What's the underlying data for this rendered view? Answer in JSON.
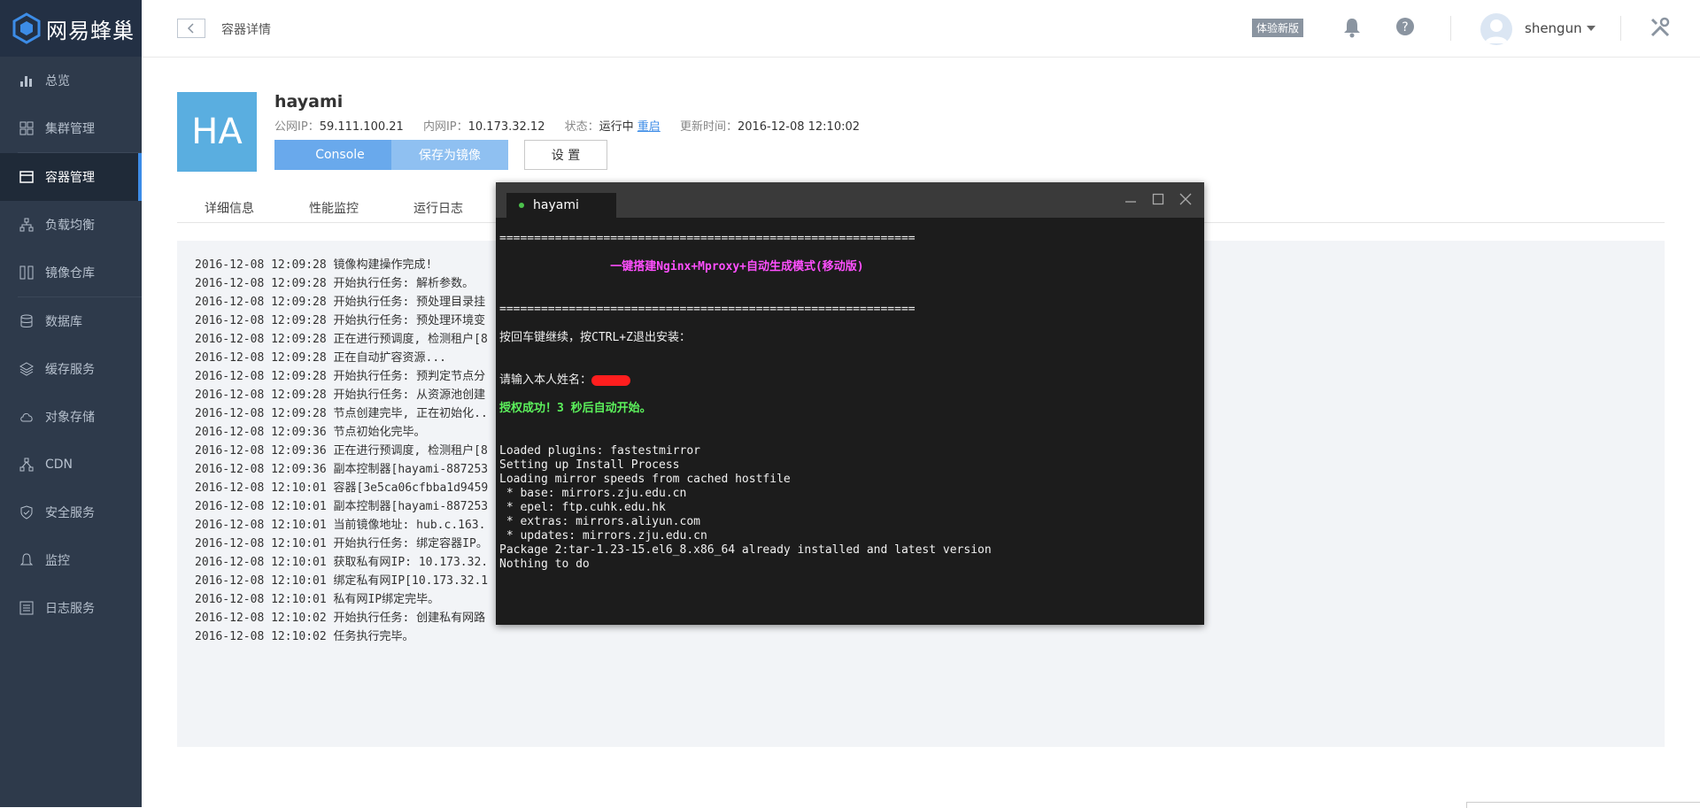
{
  "brand": {
    "name": "网易蜂巢"
  },
  "sidebar": {
    "items": [
      {
        "label": "总览",
        "icon": "bar-chart-icon"
      },
      {
        "label": "集群管理",
        "icon": "grid-icon"
      },
      {
        "label": "容器管理",
        "icon": "window-icon",
        "active": true
      },
      {
        "label": "负载均衡",
        "icon": "nodes-icon"
      },
      {
        "label": "镜像仓库",
        "icon": "columns-icon"
      },
      {
        "label": "数据库",
        "icon": "database-icon"
      },
      {
        "label": "缓存服务",
        "icon": "layers-icon"
      },
      {
        "label": "对象存储",
        "icon": "cloud-icon"
      },
      {
        "label": "CDN",
        "icon": "network-icon"
      },
      {
        "label": "安全服务",
        "icon": "shield-icon"
      },
      {
        "label": "监控",
        "icon": "bell-icon"
      },
      {
        "label": "日志服务",
        "icon": "list-icon"
      }
    ]
  },
  "header": {
    "breadcrumb": "容器详情",
    "trial_badge": "体验新版",
    "username": "shengun"
  },
  "container": {
    "avatar_text": "HA",
    "name": "hayami",
    "public_ip_label": "公网IP：",
    "public_ip": "59.111.100.21",
    "private_ip_label": "内网IP：",
    "private_ip": "10.173.32.12",
    "status_label": "状态：",
    "status": "运行中",
    "restart_link": "重启",
    "updated_label": "更新时间：",
    "updated": "2016-12-08 12:10:02"
  },
  "actions": {
    "console": "Console",
    "save_image": "保存为镜像",
    "settings": "设 置"
  },
  "tabs": [
    "详细信息",
    "性能监控",
    "运行日志"
  ],
  "logs": [
    "2016-12-08 12:09:28 镜像构建操作完成!",
    "2016-12-08 12:09:28 开始执行任务: 解析参数。",
    "2016-12-08 12:09:28 开始执行任务: 预处理目录挂",
    "2016-12-08 12:09:28 开始执行任务: 预处理环境变",
    "2016-12-08 12:09:28 正在进行预调度, 检测租户[8",
    "2016-12-08 12:09:28 正在自动扩容资源...",
    "2016-12-08 12:09:28 开始执行任务: 预判定节点分",
    "2016-12-08 12:09:28 开始执行任务: 从资源池创建",
    "2016-12-08 12:09:28 节点创建完毕, 正在初始化..",
    "2016-12-08 12:09:36 节点初始化完毕。",
    "2016-12-08 12:09:36 正在进行预调度, 检测租户[8",
    "2016-12-08 12:09:36 副本控制器[hayami-887253",
    "2016-12-08 12:10:01 容器[3e5ca06cfbba1d9459",
    "2016-12-08 12:10:01 副本控制器[hayami-887253",
    "2016-12-08 12:10:01 当前镜像地址: hub.c.163.",
    "2016-12-08 12:10:01 开始执行任务: 绑定容器IP。",
    "2016-12-08 12:10:01 获取私有网IP: 10.173.32.",
    "2016-12-08 12:10:01 绑定私有网IP[10.173.32.1",
    "2016-12-08 12:10:01 私有网IP绑定完毕。",
    "2016-12-08 12:10:02 开始执行任务: 创建私有网路",
    "2016-12-08 12:10:02 任务执行完毕。"
  ],
  "console_window": {
    "tab_title": "hayami",
    "lines": [
      {
        "text": "",
        "style": ""
      },
      {
        "text": "============================================================",
        "style": ""
      },
      {
        "text": "",
        "style": ""
      },
      {
        "text": "                一键搭建Nginx+Mproxy+自动生成模式(移动版)",
        "style": "magenta"
      },
      {
        "text": "",
        "style": ""
      },
      {
        "text": "",
        "style": ""
      },
      {
        "text": "============================================================",
        "style": ""
      },
      {
        "text": "",
        "style": ""
      },
      {
        "text": "按回车键继续，按CTRL+Z退出安装：",
        "style": ""
      },
      {
        "text": "",
        "style": ""
      },
      {
        "text": "",
        "style": ""
      },
      {
        "text": "请输入本人姓名：",
        "style": "",
        "redacted": true
      },
      {
        "text": "",
        "style": ""
      },
      {
        "text": "授权成功！3 秒后自动开始。",
        "style": "green"
      },
      {
        "text": "",
        "style": ""
      },
      {
        "text": "",
        "style": ""
      },
      {
        "text": "Loaded plugins: fastestmirror",
        "style": ""
      },
      {
        "text": "Setting up Install Process",
        "style": ""
      },
      {
        "text": "Loading mirror speeds from cached hostfile",
        "style": ""
      },
      {
        "text": " * base: mirrors.zju.edu.cn",
        "style": ""
      },
      {
        "text": " * epel: ftp.cuhk.edu.hk",
        "style": ""
      },
      {
        "text": " * extras: mirrors.aliyun.com",
        "style": ""
      },
      {
        "text": " * updates: mirrors.zju.edu.cn",
        "style": ""
      },
      {
        "text": "Package 2:tar-1.23-15.el6_8.x86_64 already installed and latest version",
        "style": ""
      },
      {
        "text": "Nothing to do",
        "style": ""
      }
    ]
  },
  "colors": {
    "sidebar_bg": "#2e3a4b",
    "accent": "#3c8ce7",
    "avatar_box": "#5aaee0",
    "console_bg": "#1c1c1c"
  }
}
